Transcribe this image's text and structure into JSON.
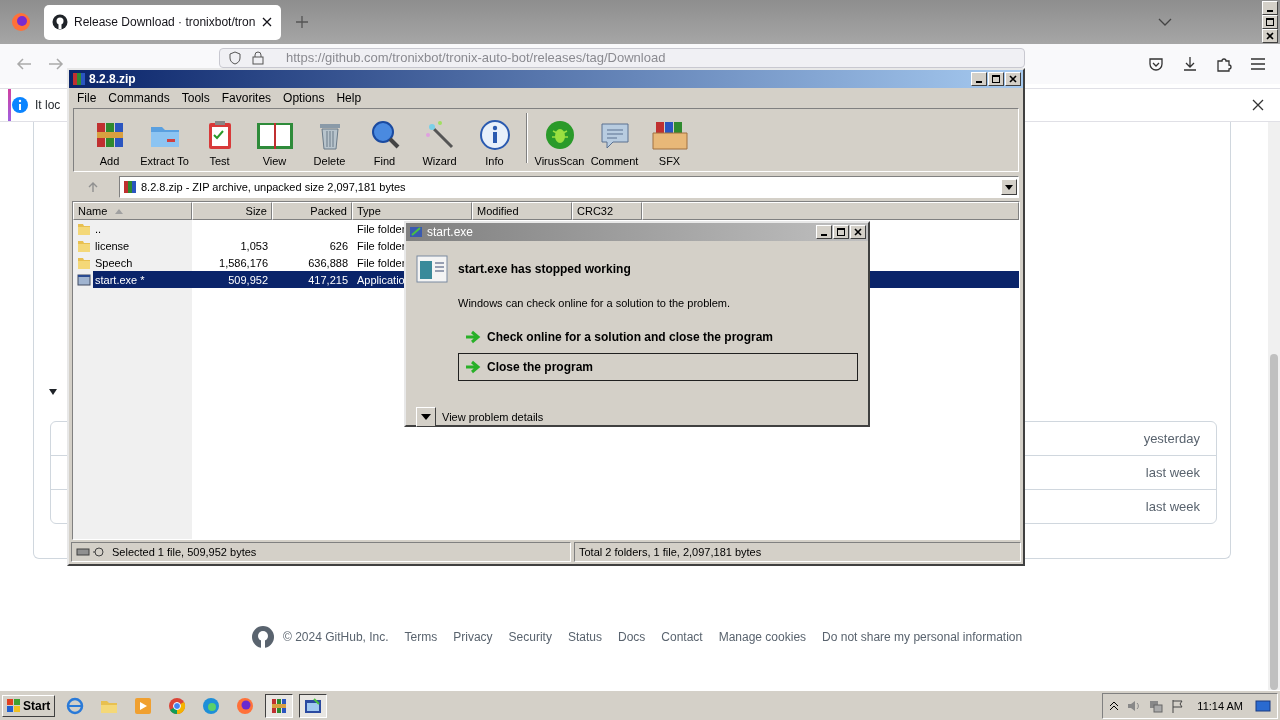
{
  "browser": {
    "tabs": [
      {
        "title": "Release Download · tronixbot/tron",
        "selected": true
      }
    ],
    "address": "https://github.com/tronixbot/tronix-auto-bot/releases/tag/Download",
    "notification": "It loc"
  },
  "page": {
    "release_items": [
      {
        "time": "yesterday"
      },
      {
        "time": "last week"
      },
      {
        "time": "last week"
      }
    ],
    "footer": {
      "copyright": "© 2024 GitHub, Inc.",
      "links": [
        "Terms",
        "Privacy",
        "Security",
        "Status",
        "Docs",
        "Contact",
        "Manage cookies",
        "Do not share my personal information"
      ]
    }
  },
  "winrar": {
    "title": "8.2.8.zip",
    "menu": [
      "File",
      "Commands",
      "Tools",
      "Favorites",
      "Options",
      "Help"
    ],
    "toolbar": [
      {
        "label": "Add"
      },
      {
        "label": "Extract To"
      },
      {
        "label": "Test"
      },
      {
        "label": "View"
      },
      {
        "label": "Delete"
      },
      {
        "label": "Find"
      },
      {
        "label": "Wizard"
      },
      {
        "label": "Info"
      },
      {
        "label": "VirusScan"
      },
      {
        "label": "Comment"
      },
      {
        "label": "SFX"
      }
    ],
    "path": "8.2.8.zip - ZIP archive, unpacked size 2,097,181 bytes",
    "columns": [
      "Name",
      "Size",
      "Packed",
      "Type",
      "Modified",
      "CRC32"
    ],
    "rows": [
      {
        "kind": "folder",
        "name": "..",
        "type": "File folder",
        "selected": false
      },
      {
        "kind": "folder",
        "name": "license",
        "size": "1,053",
        "packed": "626",
        "type": "File folder",
        "selected": false
      },
      {
        "kind": "folder",
        "name": "Speech",
        "size": "1,586,176",
        "packed": "636,888",
        "type": "File folder",
        "selected": false
      },
      {
        "kind": "file",
        "name": "start.exe *",
        "size": "509,952",
        "packed": "417,215",
        "type": "Applicatio",
        "selected": true
      }
    ],
    "status_left": "Selected 1 file, 509,952 bytes",
    "status_right": "Total 2 folders, 1 file, 2,097,181 bytes"
  },
  "dialog": {
    "title": "start.exe",
    "heading": "start.exe has stopped working",
    "message": "Windows can check online for a solution to the problem.",
    "options": [
      {
        "label": "Check online for a solution and close the program",
        "selected": false
      },
      {
        "label": "Close the program",
        "selected": true
      }
    ],
    "details": "View problem details"
  },
  "taskbar": {
    "start": "Start",
    "apps": [
      {
        "active": false
      },
      {
        "active": false
      },
      {
        "active": false
      },
      {
        "active": false
      },
      {
        "active": false
      },
      {
        "active": false
      },
      {
        "active": true
      },
      {
        "active": true
      }
    ],
    "clock": "11:14 AM"
  }
}
